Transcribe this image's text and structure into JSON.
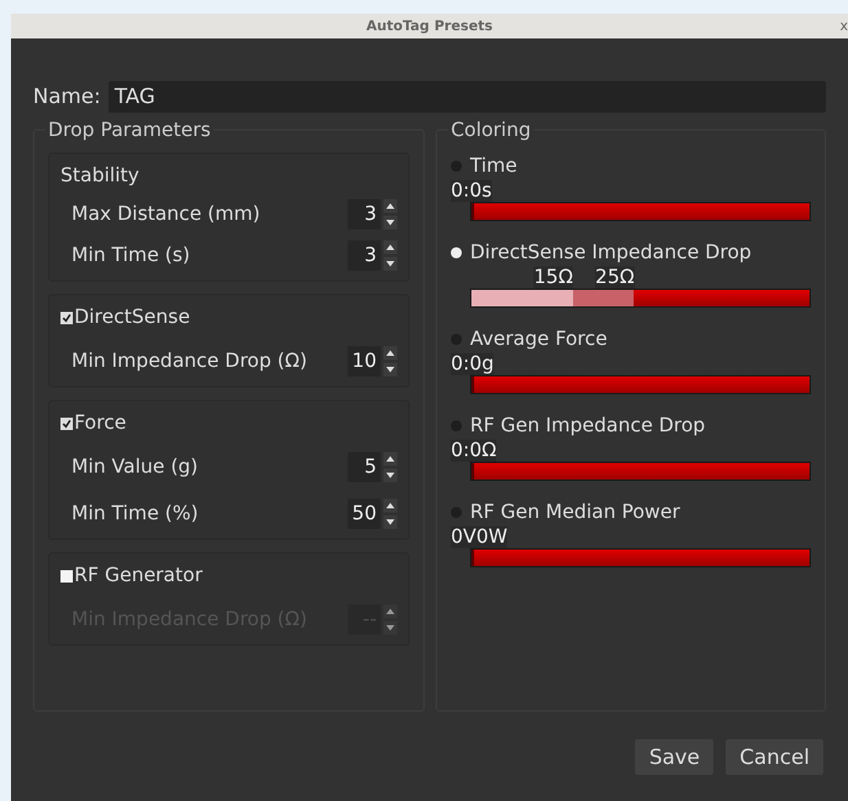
{
  "window": {
    "title": "AutoTag Presets",
    "close": "x"
  },
  "name_field": {
    "label": "Name:",
    "value": "TAG"
  },
  "drop_parameters": {
    "title": "Drop Parameters",
    "groups": [
      {
        "title": "Stability",
        "kind": "plain",
        "fields": [
          {
            "label": "Max Distance (mm)",
            "value": "3"
          },
          {
            "label": "Min Time (s)",
            "value": "3"
          }
        ]
      },
      {
        "title": "DirectSense",
        "kind": "checkbox",
        "checked": true,
        "fields": [
          {
            "label": "Min Impedance Drop (Ω)",
            "value": "10"
          }
        ]
      },
      {
        "title": "Force",
        "kind": "checkbox",
        "checked": true,
        "fields": [
          {
            "label": "Min Value (g)",
            "value": "5"
          },
          {
            "label": "Min Time (%)",
            "value": "50"
          }
        ]
      },
      {
        "title": "RF Generator",
        "kind": "checkbox",
        "checked": false,
        "fields": [
          {
            "label": "Min Impedance Drop (Ω)",
            "value": "--"
          }
        ]
      }
    ]
  },
  "coloring": {
    "title": "Coloring",
    "options": [
      {
        "label": "Time",
        "selected": false,
        "markers": [
          {
            "label": "0:0s",
            "level": 0
          }
        ]
      },
      {
        "label": "DirectSense Impedance Drop",
        "selected": true,
        "markers": [
          {
            "label": "15Ω",
            "level": 0.3
          },
          {
            "label": "25Ω",
            "level": 0.48
          }
        ]
      },
      {
        "label": "Average Force",
        "selected": false,
        "markers": [
          {
            "label": "0:0g",
            "level": 0
          }
        ]
      },
      {
        "label": "RF Gen Impedance Drop",
        "selected": false,
        "markers": [
          {
            "label": "0:0Ω",
            "level": 0
          }
        ]
      },
      {
        "label": "RF Gen Median Power",
        "selected": false,
        "markers": [
          {
            "label": "0V0W",
            "level": 0
          }
        ]
      }
    ]
  },
  "buttons": [
    "Save",
    "Cancel"
  ]
}
